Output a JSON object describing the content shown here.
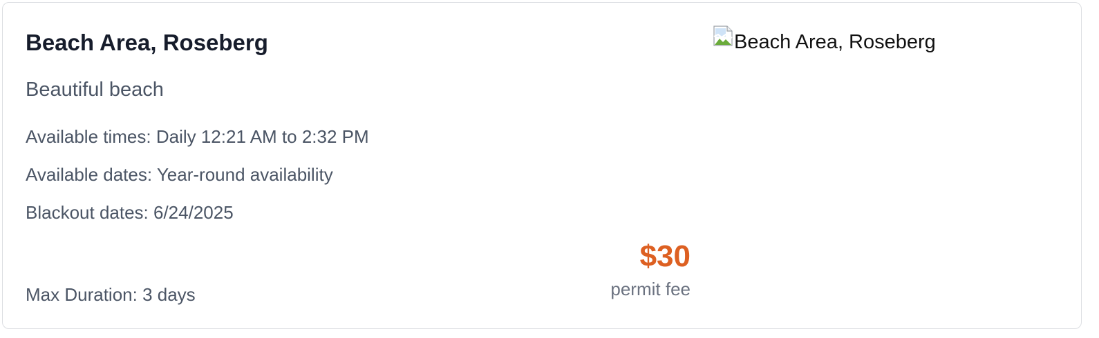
{
  "listing": {
    "title": "Beach Area, Roseberg",
    "description": "Beautiful beach",
    "available_times": "Available times: Daily 12:21 AM to 2:32 PM",
    "available_dates": "Available dates: Year-round availability",
    "blackout_dates": "Blackout dates: 6/24/2025",
    "max_duration": "Max Duration: 3 days",
    "price": "$30",
    "price_label": "permit fee",
    "image_alt": "Beach Area, Roseberg",
    "image_icon": "broken-image-icon"
  },
  "colors": {
    "title": "#161c2b",
    "body_text": "#4b5565",
    "price": "#dd6022",
    "muted": "#6b7280",
    "border": "#dcdee2"
  }
}
